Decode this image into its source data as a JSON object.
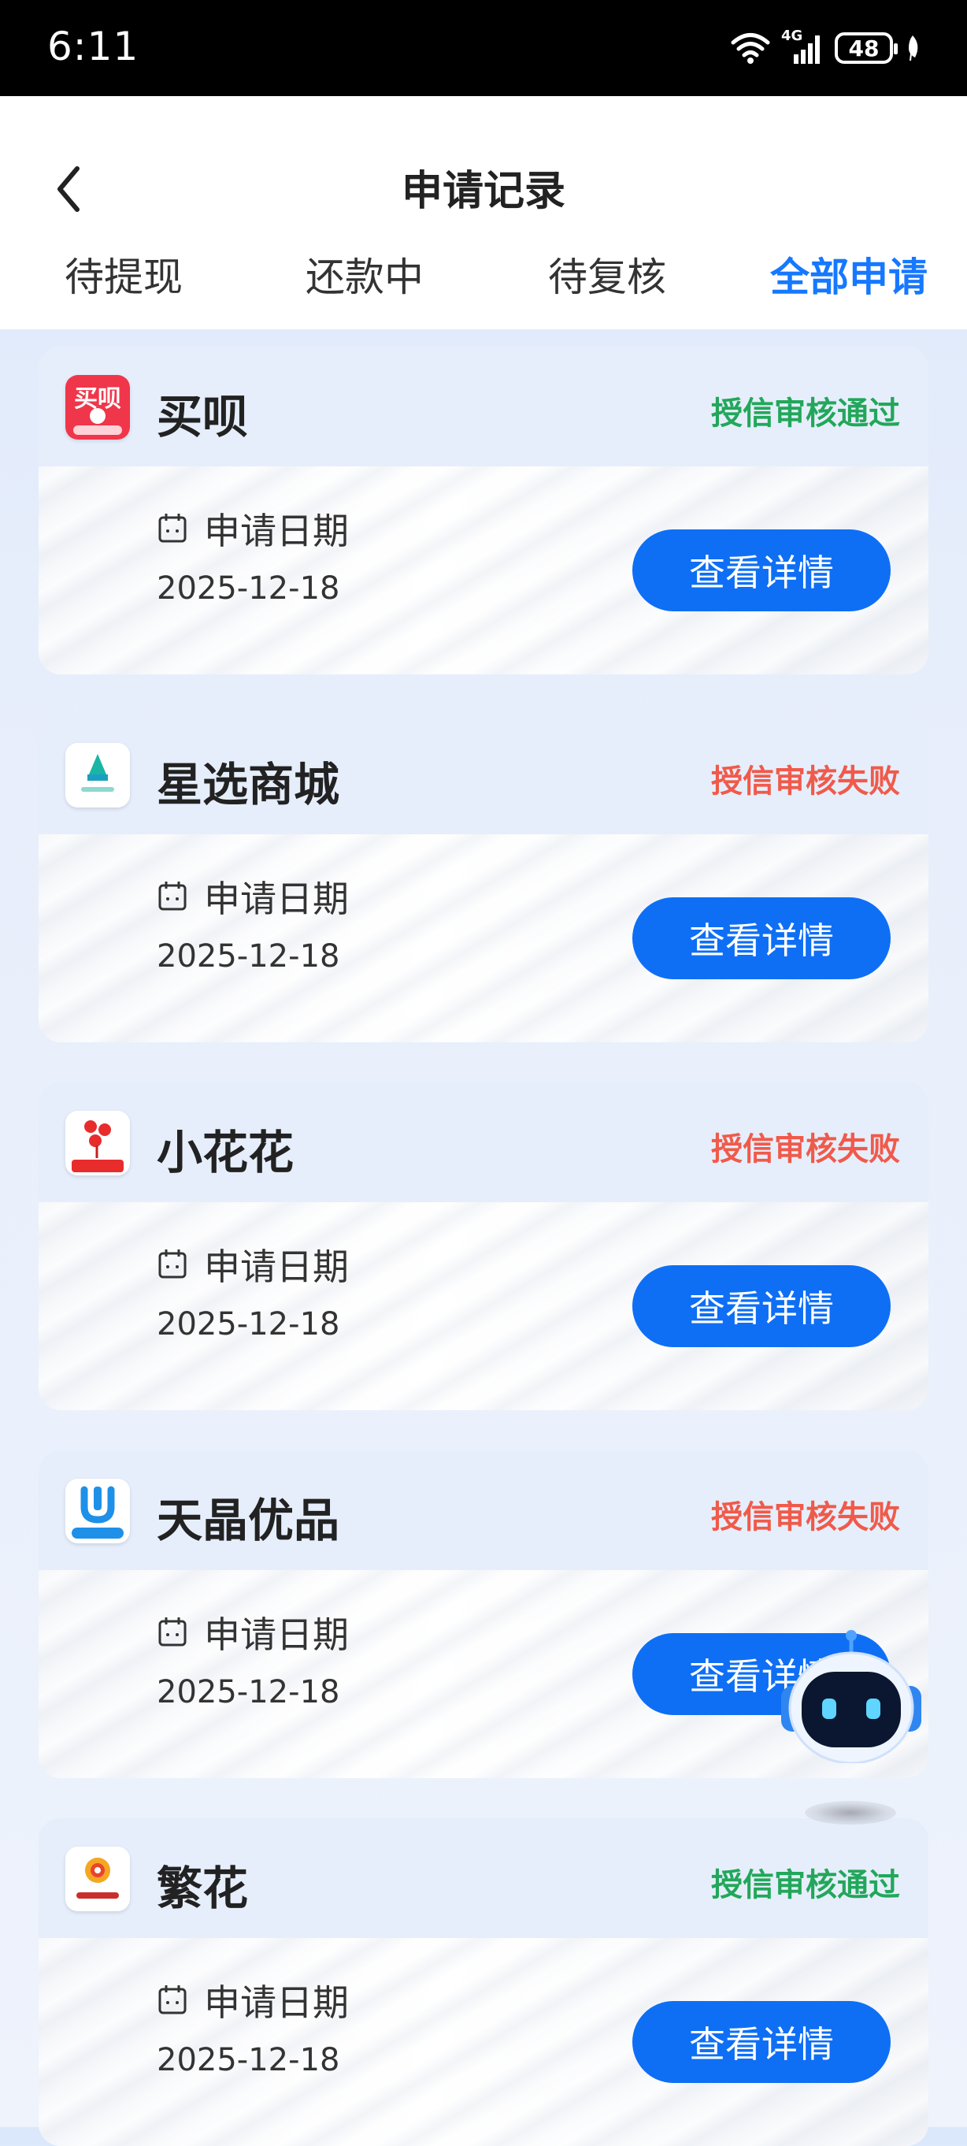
{
  "status_bar": {
    "time": "6:11",
    "network": "4G",
    "battery": "48"
  },
  "header": {
    "title": "申请记录"
  },
  "tabs": [
    {
      "label": "待提现",
      "active": false
    },
    {
      "label": "还款中",
      "active": false
    },
    {
      "label": "待复核",
      "active": false
    },
    {
      "label": "全部申请",
      "active": true
    }
  ],
  "cards": [
    {
      "name": "买呗",
      "status": "授信审核通过",
      "status_type": "pass",
      "logo_icon": "maibei-logo-icon",
      "date_label": "申请日期",
      "date": "2025-12-18",
      "button": "查看详情"
    },
    {
      "name": "星选商城",
      "status": "授信审核失败",
      "status_type": "fail",
      "logo_icon": "xingxuan-logo-icon",
      "date_label": "申请日期",
      "date": "2025-12-18",
      "button": "查看详情"
    },
    {
      "name": "小花花",
      "status": "授信审核失败",
      "status_type": "fail",
      "logo_icon": "xiaohuahua-logo-icon",
      "date_label": "申请日期",
      "date": "2025-12-18",
      "button": "查看详情"
    },
    {
      "name": "天晶优品",
      "status": "授信审核失败",
      "status_type": "fail",
      "logo_icon": "tianjing-logo-icon",
      "date_label": "申请日期",
      "date": "2025-12-18",
      "button": "查看详情"
    },
    {
      "name": "繁花",
      "status": "授信审核通过",
      "status_type": "pass",
      "logo_icon": "fanhua-logo-icon",
      "date_label": "申请日期",
      "date": "2025-12-18",
      "button": "查看详情"
    }
  ],
  "colors": {
    "accent": "#1678ff",
    "button": "#0e6ff5",
    "pass": "#22a75a",
    "fail": "#f05a4a"
  }
}
